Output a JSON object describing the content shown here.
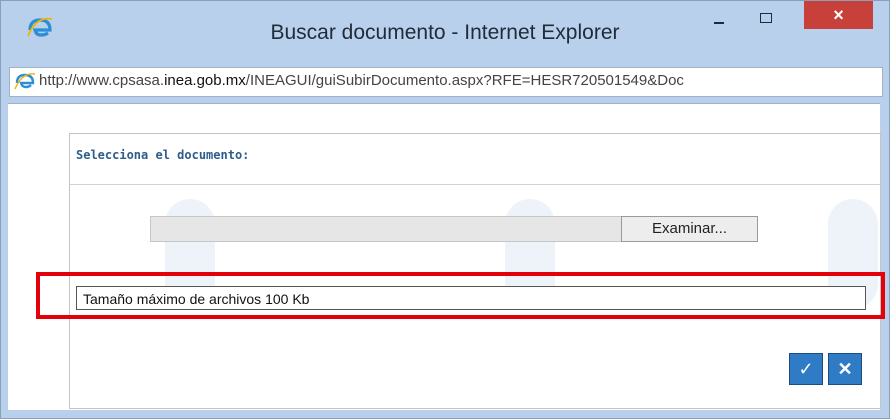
{
  "window": {
    "title": "Buscar documento - Internet Explorer",
    "close_symbol": "×",
    "address": {
      "prefix": "http://www.cpsasa.",
      "domain": "inea.gob.mx",
      "path": "/INEAGUI/guiSubirDocumento.aspx?RFE=HESR720501549&Doc"
    }
  },
  "form": {
    "heading": "Selecciona el documento:",
    "browse_label": "Examinar...",
    "max_size_text": "Tamaño máximo de archivos 100 Kb",
    "accept_symbol": "✓",
    "cancel_symbol": "✕"
  },
  "icons": [
    "ie-logo-icon",
    "minimize-icon",
    "maximize-icon",
    "close-icon",
    "ie-page-icon",
    "check-icon",
    "close-x-icon"
  ],
  "colors": {
    "titlebar": "#b8d0ec",
    "close_button": "#c7403a",
    "action_buttons": "#2f7bc6",
    "highlight": "#e3000b",
    "heading": "#2d5d8c"
  }
}
